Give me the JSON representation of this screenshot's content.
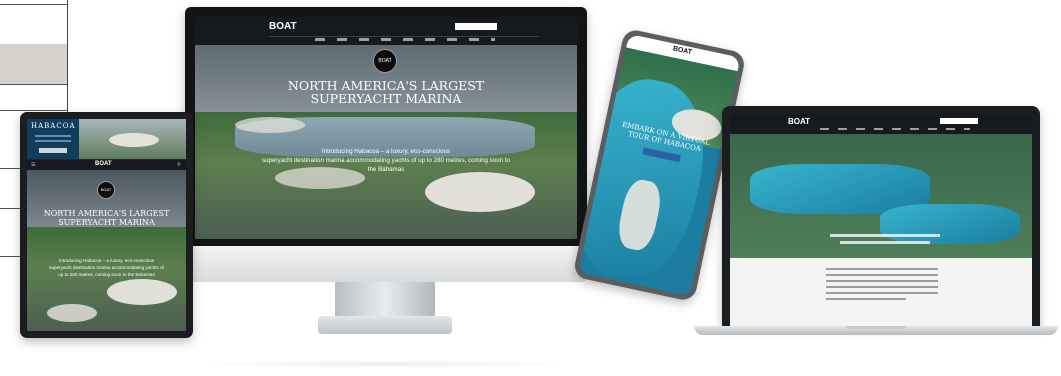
{
  "brand": {
    "logo": "BOAT"
  },
  "desktop": {
    "logo": "BOAT",
    "hero_title_line1": "NORTH AMERICA'S LARGEST",
    "hero_title_line2": "SUPERYACHT MARINA",
    "hero_sub_line1": "Introducing Habacoa – a luxury, eco-conscious",
    "hero_sub_line2": "superyacht destination marina accommodating yachts of up to 280 metres, coming soon to",
    "hero_sub_line3": "the Bahamas"
  },
  "tablet": {
    "ad_brand": "HABACOA",
    "logo": "BOAT",
    "hero_title_line1": "NORTH AMERICA'S LARGEST",
    "hero_title_line2": "SUPERYACHT MARINA",
    "hero_sub_line1": "Introducing Habacoa – a luxury, eco-conscious",
    "hero_sub_line2": "superyacht destination marina accommodating yachts of",
    "hero_sub_line3": "up to 280 metres, coming soon to the Bahamas"
  },
  "phone": {
    "logo": "BOAT",
    "hero_title_line1": "EMBARK ON A VIRTUAL",
    "hero_title_line2": "TOUR OF HABACOA"
  },
  "laptop": {
    "logo": "BOAT"
  },
  "colors": {
    "nav": "#161a1f",
    "water": "#38b5cd",
    "greenery": "#3f6b3c",
    "button": "#2b62a5"
  }
}
